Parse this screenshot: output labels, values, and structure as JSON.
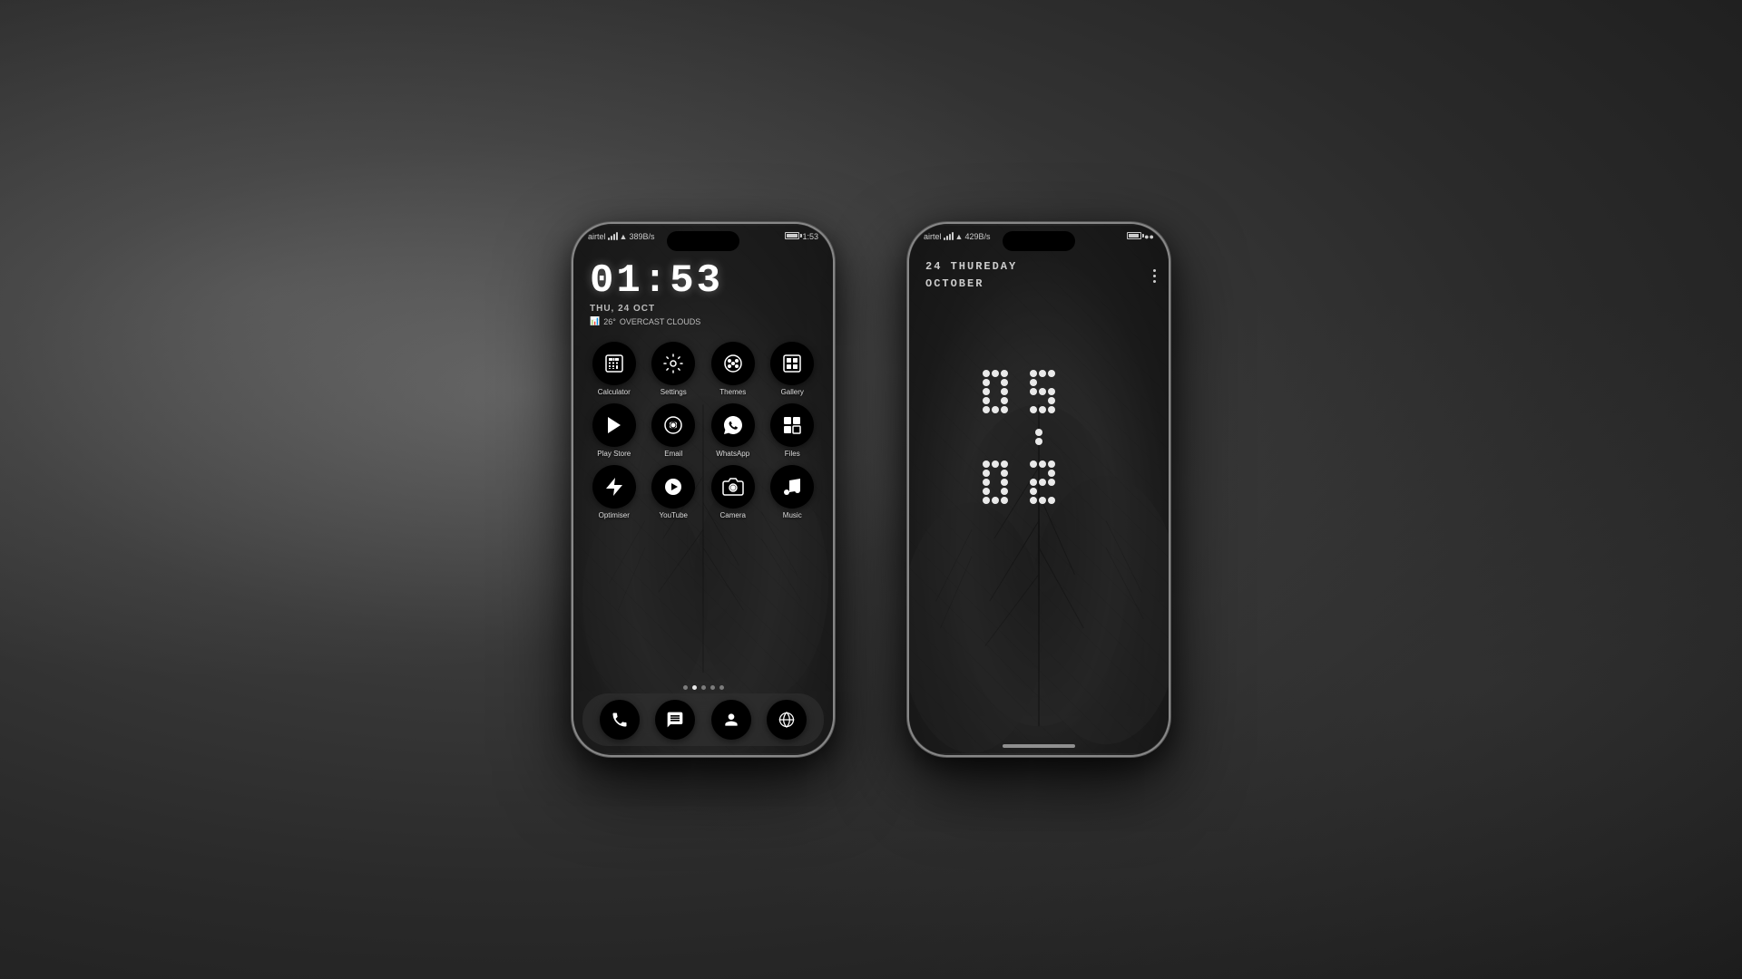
{
  "background": {
    "color": "#2d2d2d"
  },
  "phone1": {
    "status_bar": {
      "carrier": "airtel",
      "speed": "389B/s",
      "time": "1:53",
      "battery": "●●"
    },
    "clock": {
      "time": "01:53",
      "date": "THU, 24 OCT",
      "weather_icon": "📊",
      "temp": "26°",
      "condition": "OVERCAST CLOUDS"
    },
    "apps_row1": [
      {
        "id": "calculator",
        "label": "Calculator",
        "icon": "calculator"
      },
      {
        "id": "settings",
        "label": "Settings",
        "icon": "settings"
      },
      {
        "id": "themes",
        "label": "Themes",
        "icon": "themes"
      },
      {
        "id": "gallery",
        "label": "Gallery",
        "icon": "gallery"
      }
    ],
    "apps_row2": [
      {
        "id": "playstore",
        "label": "Play Store",
        "icon": "playstore"
      },
      {
        "id": "email",
        "label": "Email",
        "icon": "email"
      },
      {
        "id": "whatsapp",
        "label": "WhatsApp",
        "icon": "whatsapp"
      },
      {
        "id": "files",
        "label": "Files",
        "icon": "files"
      }
    ],
    "apps_row3": [
      {
        "id": "optimiser",
        "label": "Optimiser",
        "icon": "optimiser"
      },
      {
        "id": "youtube",
        "label": "YouTube",
        "icon": "youtube"
      },
      {
        "id": "camera",
        "label": "Camera",
        "icon": "camera"
      },
      {
        "id": "music",
        "label": "Music",
        "icon": "music"
      }
    ],
    "dock": [
      {
        "id": "phone",
        "icon": "phone"
      },
      {
        "id": "chat",
        "icon": "chat"
      },
      {
        "id": "profile",
        "icon": "profile"
      },
      {
        "id": "browser",
        "icon": "browser"
      }
    ]
  },
  "phone2": {
    "status_bar": {
      "carrier": "airtel",
      "speed": "429B/s",
      "time": "●●",
      "battery": "●●"
    },
    "lock_date_line1": "24 THUREDAY",
    "lock_date_line2": "OCTOBER",
    "dot_clock_top": "05",
    "dot_clock_bottom": "02"
  }
}
